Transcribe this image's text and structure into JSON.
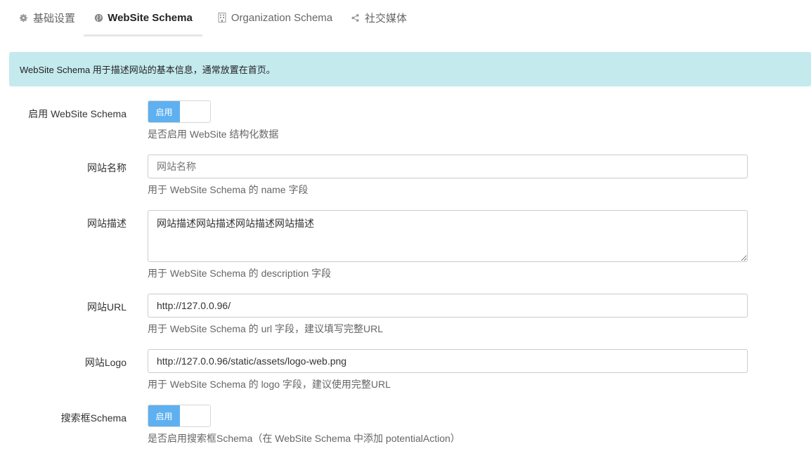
{
  "tabs": [
    {
      "label": "基础设置",
      "icon": "gear-icon"
    },
    {
      "label": "WebSite Schema",
      "icon": "globe-icon",
      "active": true
    },
    {
      "label": "Organization Schema",
      "icon": "building-icon"
    },
    {
      "label": "社交媒体",
      "icon": "share-icon"
    }
  ],
  "alert": {
    "text": "WebSite Schema 用于描述网站的基本信息，通常放置在首页。"
  },
  "form": {
    "enable": {
      "label": "启用 WebSite Schema",
      "switch_label": "启用",
      "help": "是否启用 WebSite 结构化数据"
    },
    "site_name": {
      "label": "网站名称",
      "value": "",
      "placeholder": "网站名称",
      "help": "用于 WebSite Schema 的 name 字段"
    },
    "site_desc": {
      "label": "网站描述",
      "value": "网站描述网站描述网站描述网站描述",
      "help": "用于 WebSite Schema 的 description 字段"
    },
    "site_url": {
      "label": "网站URL",
      "value": "http://127.0.0.96/",
      "help": "用于 WebSite Schema 的 url 字段，建议填写完整URL"
    },
    "site_logo": {
      "label": "网站Logo",
      "value": "http://127.0.0.96/static/assets/logo-web.png",
      "help": "用于 WebSite Schema 的 logo 字段，建议使用完整URL"
    },
    "search_box": {
      "label": "搜索框Schema",
      "switch_label": "启用",
      "help": "是否启用搜索框Schema（在 WebSite Schema 中添加 potentialAction）"
    }
  },
  "colors": {
    "alert_bg": "#c4eaee",
    "switch_on": "#5eb0f0"
  }
}
